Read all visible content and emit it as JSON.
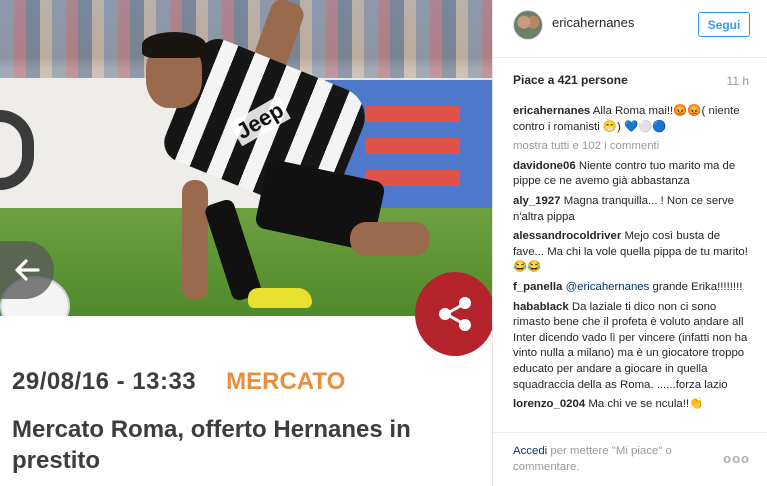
{
  "article": {
    "date": "29/08/16 - 13:33",
    "category": "MERCATO",
    "headline": "Mercato Roma, offerto Hernanes in prestito",
    "shirt_text": "Jeep",
    "colors": {
      "category": "#e98e3c",
      "share_button": "#b5232d",
      "text": "#3d3d3d"
    },
    "icons": {
      "back": "arrow-left-icon",
      "share": "share-icon"
    }
  },
  "instagram": {
    "username": "ericahernanes",
    "follow_label": "Segui",
    "likes": "Piace a 421 persone",
    "time": "11 h",
    "caption": {
      "user": "ericahernanes",
      "text": "Alla Roma mai!!😡😡( niente contro i romanisti 😁) 💙⚪🔵"
    },
    "view_all": "mostra tutti e 102 i commenti",
    "comments": [
      {
        "user": "davidone06",
        "text": "Niente contro tuo marito ma de pippe ce ne avemo già abbastanza"
      },
      {
        "user": "aly_1927",
        "text": "Magna tranquilla... ! Non ce serve n'altra pippa"
      },
      {
        "user": "alessandrocoldriver",
        "text": "Mejo così busta de fave... Ma chi la vole quella pippa de tu marito! 😂😂"
      },
      {
        "user": "f_panella",
        "mention": "@ericahernanes",
        "text": "grande Erika!!!!!!!!"
      },
      {
        "user": "hababIack",
        "text": "Da laziale ti dico non ci sono rimasto bene che il profeta è voluto andare all Inter dicendo vado lì per vincere (infatti non ha vinto nulla a milano) ma è un giocatore troppo educato per andare a giocare in quella squadraccia della as Roma. ......forza lazio"
      },
      {
        "user": "lorenzo_0204",
        "text": "Ma chi ve se ncula!!👏"
      }
    ],
    "login": {
      "link": "Accedi",
      "text": "per mettere \"Mi piace\" o commentare."
    },
    "more": "ooo",
    "colors": {
      "link": "#3897f0",
      "mention": "#003569",
      "muted": "#999999"
    }
  }
}
